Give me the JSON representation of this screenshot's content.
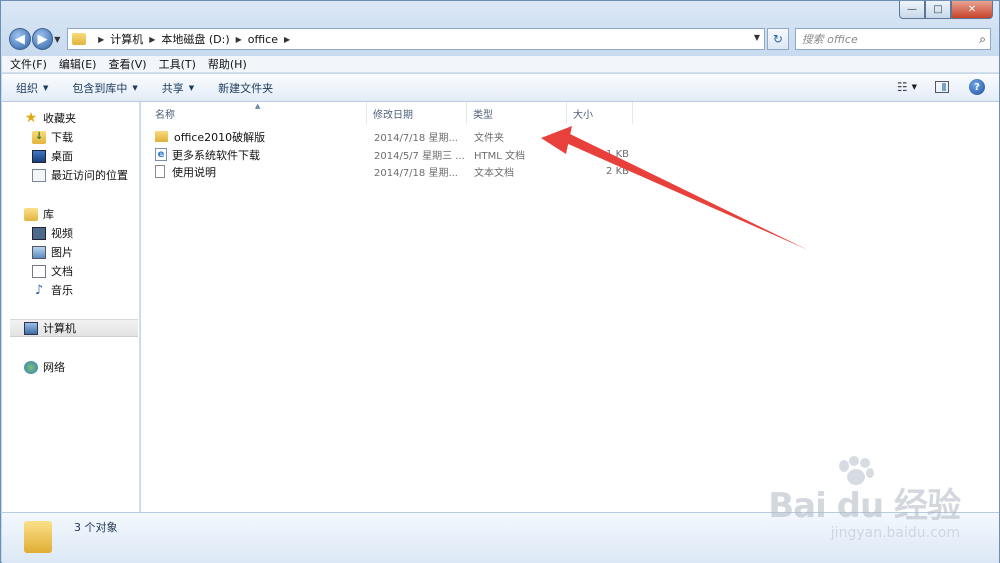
{
  "window": {
    "caption_min": "—",
    "caption_max": "□",
    "caption_close": "✕"
  },
  "address": {
    "crumbs": [
      "计算机",
      "本地磁盘 (D:)",
      "office"
    ]
  },
  "search": {
    "placeholder": "搜索 office"
  },
  "menubar": {
    "items": [
      "文件(F)",
      "编辑(E)",
      "查看(V)",
      "工具(T)",
      "帮助(H)"
    ]
  },
  "cmdbar": {
    "organize": "组织",
    "include_library": "包含到库中",
    "share": "共享",
    "new_folder": "新建文件夹"
  },
  "navpane": {
    "favorites": "收藏夹",
    "downloads": "下载",
    "desktop": "桌面",
    "recent": "最近访问的位置",
    "libraries": "库",
    "videos": "视频",
    "pictures": "图片",
    "documents": "文档",
    "music": "音乐",
    "computer": "计算机",
    "network": "网络"
  },
  "columns": {
    "name": "名称",
    "date": "修改日期",
    "type": "类型",
    "size": "大小"
  },
  "files": [
    {
      "name": "office2010破解版",
      "date": "2014/7/18 星期...",
      "type": "文件夹",
      "size": "",
      "icon": "folder-icon"
    },
    {
      "name": "更多系统软件下载",
      "date": "2014/5/7 星期三 ...",
      "type": "HTML 文档",
      "size": "1 KB",
      "icon": "html-file-icon"
    },
    {
      "name": "使用说明",
      "date": "2014/7/18 星期...",
      "type": "文本文档",
      "size": "2 KB",
      "icon": "text-file-icon"
    }
  ],
  "details": {
    "count": "3 个对象"
  },
  "watermark": {
    "main": "Bai du 经验",
    "sub": "jingyan.baidu.com"
  },
  "colors": {
    "arrow": "#e8403a",
    "accent": "#2e62a8"
  }
}
